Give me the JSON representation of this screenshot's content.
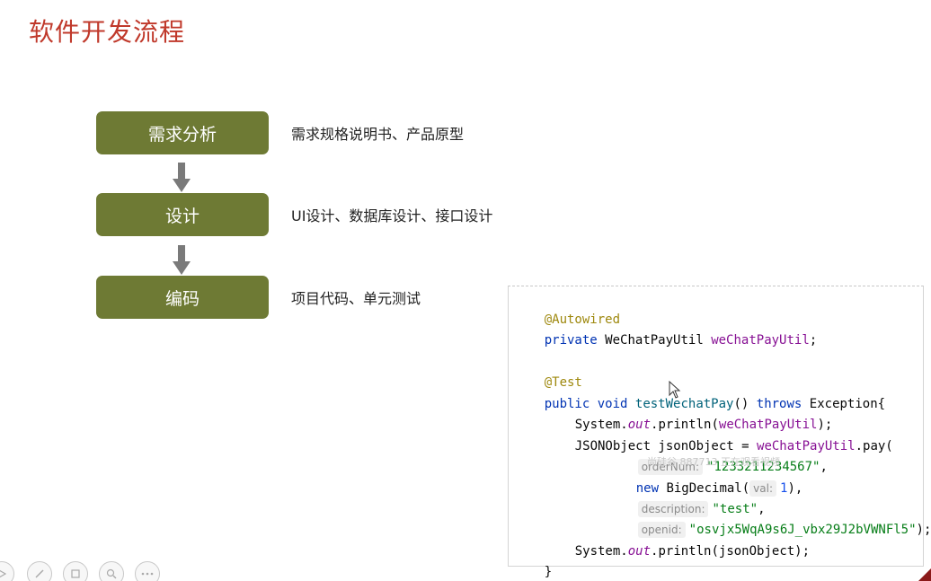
{
  "title": "软件开发流程",
  "steps": [
    {
      "label": "需求分析",
      "desc": "需求规格说明书、产品原型"
    },
    {
      "label": "设计",
      "desc": "UI设计、数据库设计、接口设计"
    },
    {
      "label": "编码",
      "desc": "项目代码、单元测试"
    }
  ],
  "code": {
    "l1": "@Autowired",
    "l2_kw": "private",
    "l2_type": "WeChatPayUtil",
    "l2_field": "weChatPayUtil",
    "l2_end": ";",
    "l4": "@Test",
    "l5_kw1": "public",
    "l5_kw2": "void",
    "l5_name": "testWechatPay",
    "l5_mid": "()",
    "l5_throws": "throws",
    "l5_end": "Exception{",
    "l6_a": "System.",
    "l6_out": "out",
    "l6_b": ".println(",
    "l6_field": "weChatPayUtil",
    "l6_end": ");",
    "l7_a": "JSONObject jsonObject = ",
    "l7_field": "weChatPayUtil",
    "l7_end": ".pay(",
    "l8_hint": "orderNum:",
    "l8_val": "\"1233211234567\"",
    "l8_end": ",",
    "l9_kw": "new",
    "l9_a": "BigDecimal(",
    "l9_hint": "val:",
    "l9_val": "1",
    "l9_end": "),",
    "l10_hint": "description:",
    "l10_val": "\"test\"",
    "l10_end": ",",
    "l11_hint": "openid:",
    "l11_val": "\"osvjx5WqA9s6J_vbx29J2bVWNFl5\"",
    "l11_end": ");",
    "l12_a": "System.",
    "l12_out": "out",
    "l12_b": ".println(jsonObject);",
    "l13": "}"
  },
  "watermark": "尚硅谷 887713 正在观看视频",
  "toolbar_icons": [
    "play-icon",
    "pen-icon",
    "slides-icon",
    "zoom-icon",
    "more-icon"
  ]
}
